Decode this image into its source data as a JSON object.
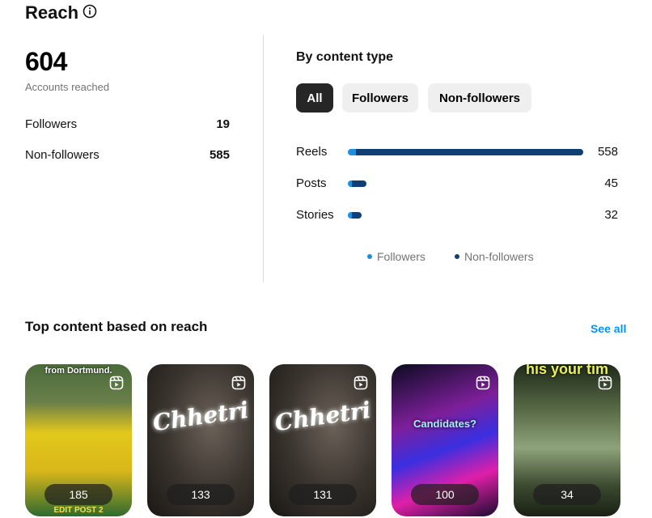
{
  "header": {
    "title": "Reach"
  },
  "summary": {
    "total": "604",
    "total_label": "Accounts reached",
    "rows": [
      {
        "label": "Followers",
        "value": "19"
      },
      {
        "label": "Non-followers",
        "value": "585"
      }
    ]
  },
  "by_content": {
    "title": "By content type",
    "filters": [
      "All",
      "Followers",
      "Non-followers"
    ],
    "selected_filter": "All",
    "rows": [
      {
        "label": "Reels",
        "value": "558",
        "total": 558
      },
      {
        "label": "Posts",
        "value": "45",
        "total": 45
      },
      {
        "label": "Stories",
        "value": "32",
        "total": 32
      }
    ],
    "legend": [
      "Followers",
      "Non-followers"
    ],
    "colors": {
      "followers": "#1c8ee0",
      "non_followers": "#0f3f74"
    }
  },
  "top_content": {
    "title": "Top content based on reach",
    "see_all": "See all",
    "items": [
      {
        "reach": "185",
        "caption": "from Dortmund.",
        "footer": "EDIT  POST 2"
      },
      {
        "reach": "133",
        "caption": "Chhetri"
      },
      {
        "reach": "131",
        "caption": "Chhetri"
      },
      {
        "reach": "100",
        "caption": "Candidates?"
      },
      {
        "reach": "34",
        "caption": "his your tim"
      }
    ]
  }
}
